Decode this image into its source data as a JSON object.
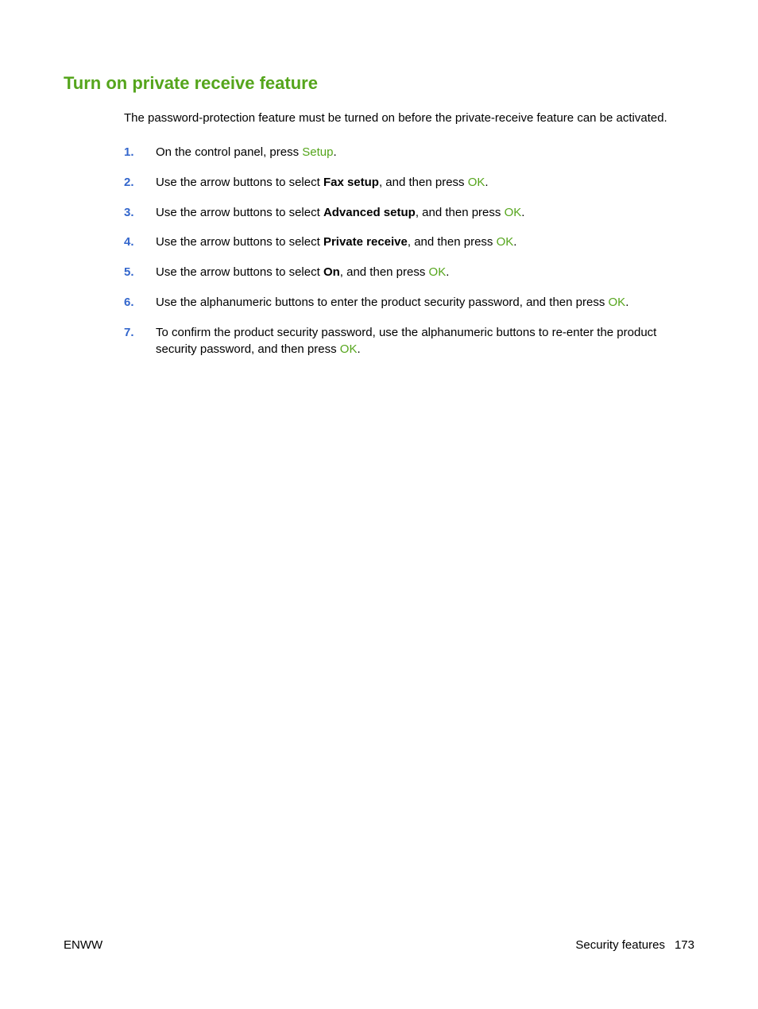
{
  "heading": "Turn on private receive feature",
  "intro": "The password-protection feature must be turned on before the private-receive feature can be activated.",
  "steps": [
    {
      "num": "1.",
      "pre": "On the control panel, press ",
      "action": "Setup",
      "post": "."
    },
    {
      "num": "2.",
      "pre": "Use the arrow buttons to select ",
      "bold": "Fax setup",
      "mid": ", and then press ",
      "action": "OK",
      "post": "."
    },
    {
      "num": "3.",
      "pre": "Use the arrow buttons to select ",
      "bold": "Advanced setup",
      "mid": ", and then press ",
      "action": "OK",
      "post": "."
    },
    {
      "num": "4.",
      "pre": "Use the arrow buttons to select ",
      "bold": "Private receive",
      "mid": ", and then press ",
      "action": "OK",
      "post": "."
    },
    {
      "num": "5.",
      "pre": "Use the arrow buttons to select ",
      "bold": "On",
      "mid": ", and then press ",
      "action": "OK",
      "post": "."
    },
    {
      "num": "6.",
      "pre": "Use the alphanumeric buttons to enter the product security password, and then press ",
      "action": "OK",
      "post": "."
    },
    {
      "num": "7.",
      "pre": "To confirm the product security password, use the alphanumeric buttons to re-enter the product security password, and then press ",
      "action": "OK",
      "post": "."
    }
  ],
  "footer": {
    "left": "ENWW",
    "section": "Security features",
    "page": "173"
  }
}
